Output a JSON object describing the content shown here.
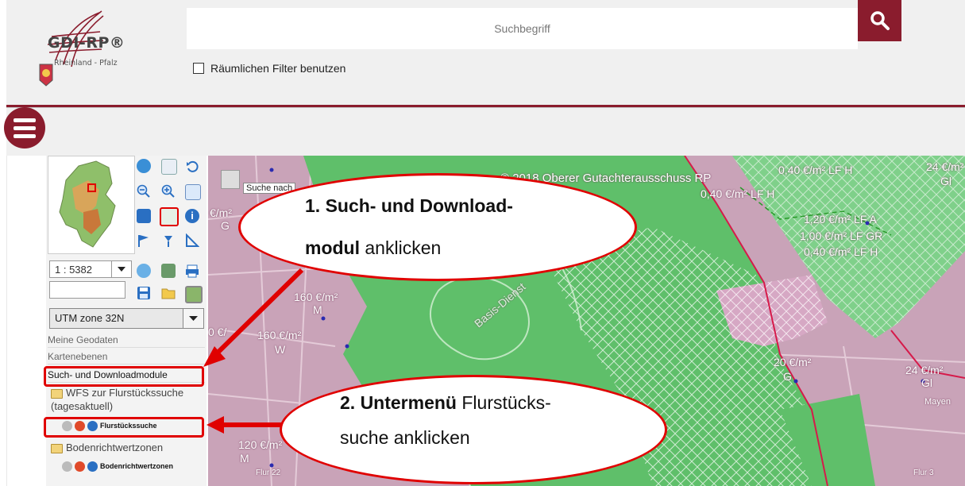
{
  "header": {
    "logo_text": "GDI-RP®",
    "logo_subtitle": "Rheinland - Pfalz",
    "search_placeholder": "Suchbegriff",
    "spatial_filter_label": "Räumlichen Filter benutzen"
  },
  "sidebar": {
    "scale_value": "1 : 5382",
    "crs_value": "UTM zone 32N",
    "tree": {
      "my_geodata": "Meine Geodaten",
      "map_layers": "Kartenebenen",
      "search_download": "Such- und Downloadmodule",
      "wfs_folder": "WFS zur Flurstückssuche (tagesaktuell)",
      "parcel_search": "Flurstückssuche",
      "bodenrichtwert_folder": "Bodenrichtwertzonen",
      "bodenrichtwert_item": "Bodenrichtwertzonen"
    }
  },
  "map": {
    "tooltip": "Suche nach",
    "copyright": "© 2018 Oberer Gutachterausschuss RP",
    "labels": {
      "lf_h_top": "0,40 €/m² LF H",
      "lf_h_mid": "0,40 €/m² LF H",
      "lf_a": "1,20 €/m² LF A",
      "lf_gr": "1,00 €/m² LF GR",
      "lf_h_right": "0,40 €/m² LF H",
      "e24_top": "24 €/m²",
      "gl_top": "Gl",
      "e160_a": "160 €/m²",
      "m_a": "M",
      "e160_b": "160 €/m²",
      "w_b": "W",
      "e20": "20 €/m²",
      "g_20": "G",
      "e24_right": "24 €/m²",
      "gl_right": "Gl",
      "mayen": "Mayen",
      "e120": "120 €/m²",
      "m_120": "M",
      "flur22": "Flur 22",
      "flur3": "Flur 3",
      "basis": "Basis-Dienst",
      "left_frag": "€/m²",
      "left_frag2": "G",
      "left_frag3": "0 €/"
    }
  },
  "annotations": {
    "step1_bold": "1. Such- und Download-",
    "step1_line2_bold": "modul",
    "step1_line2_rest": " anklicken",
    "step2_bold": "2. Untermenü",
    "step2_rest": " Flurstücks-",
    "step2_line2": "suche anklicken"
  },
  "colors": {
    "brand": "#8a1c2d",
    "callout": "#e00000",
    "forest": "#5fbf6a",
    "urban": "#c9a0b5"
  }
}
